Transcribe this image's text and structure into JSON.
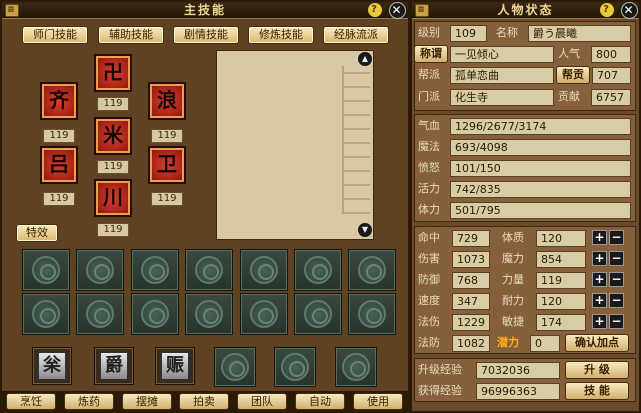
{
  "left": {
    "title": "主技能",
    "tabs": [
      "师门技能",
      "辅助技能",
      "剧情技能",
      "修炼技能",
      "经脉流派"
    ],
    "skills": [
      {
        "glyph": "卍",
        "level": "119"
      },
      {
        "glyph": "齐",
        "level": "119"
      },
      {
        "glyph": "浪",
        "level": "119"
      },
      {
        "glyph": "米",
        "level": "119"
      },
      {
        "glyph": "吕",
        "level": "119"
      },
      {
        "glyph": "卫",
        "level": "119"
      },
      {
        "glyph": "川",
        "level": "119"
      }
    ],
    "special_label": "特效",
    "special_skills": [
      "枀",
      "爵",
      "赈"
    ],
    "bottom_buttons": [
      "烹饪",
      "炼药",
      "摆摊",
      "拍卖",
      "团队",
      "自动",
      "使用"
    ]
  },
  "right": {
    "title": "人物状态",
    "level_label": "级别",
    "level": "109",
    "name_label": "名称",
    "name": "爵う晨曦",
    "title_btn": "称谓",
    "title_value": "一见倾心",
    "popularity_label": "人气",
    "popularity": "800",
    "gang_label": "帮派",
    "gang": "孤单恋曲",
    "contribution_btn": "帮贡",
    "contribution": "707",
    "sect_label": "门派",
    "sect": "化生寺",
    "merit_label": "贡献",
    "merit": "6757",
    "vitals": [
      {
        "label": "气血",
        "value": "1296/2677/3174"
      },
      {
        "label": "魔法",
        "value": "693/4098"
      },
      {
        "label": "愤怒",
        "value": "101/150"
      },
      {
        "label": "活力",
        "value": "742/835"
      },
      {
        "label": "体力",
        "value": "501/795"
      }
    ],
    "stats": [
      {
        "l1": "命中",
        "v1": "729",
        "l2": "体质",
        "v2": "120"
      },
      {
        "l1": "伤害",
        "v1": "1073",
        "l2": "魔力",
        "v2": "854"
      },
      {
        "l1": "防御",
        "v1": "768",
        "l2": "力量",
        "v2": "119"
      },
      {
        "l1": "速度",
        "v1": "347",
        "l2": "耐力",
        "v2": "120"
      },
      {
        "l1": "法伤",
        "v1": "1229",
        "l2": "敏捷",
        "v2": "174"
      }
    ],
    "fafang_label": "法防",
    "fafang": "1082",
    "potential_label": "潜力",
    "potential": "0",
    "confirm_btn": "确认加点",
    "upgrade_label": "升级经验",
    "upgrade_exp": "7032036",
    "upgrade_btn": "升 级",
    "gained_label": "获得经验",
    "gained_exp": "96996363",
    "skill_btn": "技 能"
  }
}
